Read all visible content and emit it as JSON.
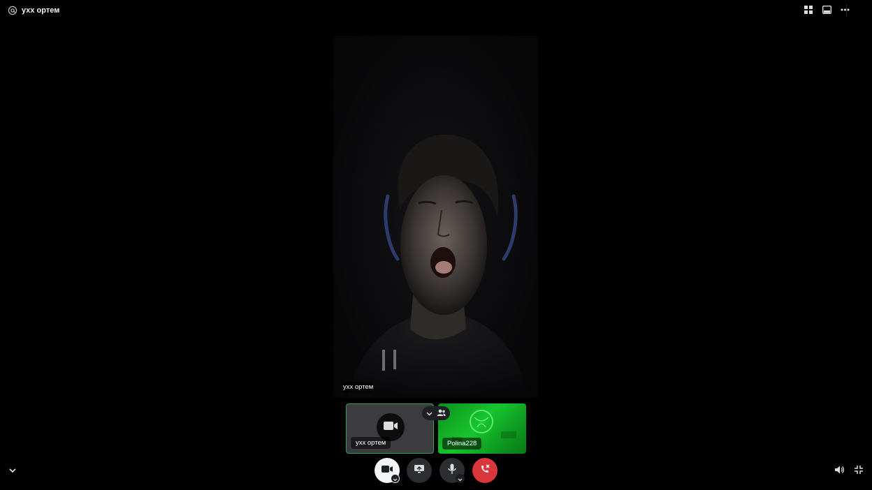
{
  "header": {
    "title": "ухх ортем",
    "icons": [
      "at-icon",
      "grid-layout-icon",
      "popout-icon",
      "more-icon"
    ]
  },
  "main_video": {
    "participant_name": "ухх ортем"
  },
  "tiles": [
    {
      "name": "ухх ортем",
      "state": "camera-off",
      "icon": "video-camera-icon",
      "border_color": "#23a55a"
    },
    {
      "name": "Polina228",
      "state": "video",
      "background_color": "#18c52e"
    }
  ],
  "tile_pill_icons": [
    "chevron-down-icon",
    "users-icon"
  ],
  "controls": {
    "buttons": [
      "camera-button",
      "screen-share-button",
      "microphone-button",
      "end-call-button"
    ],
    "colors": {
      "camera": "#f2f3f5",
      "neutral": "#2b2d31",
      "end_call": "#da373c"
    }
  },
  "footer_icons": [
    "collapse-chevron-icon",
    "volume-icon",
    "exit-fullscreen-icon"
  ]
}
